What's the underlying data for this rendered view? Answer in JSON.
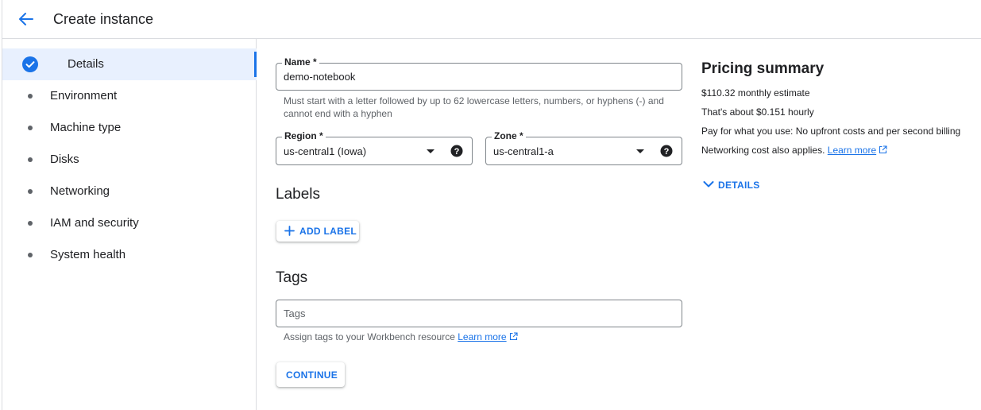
{
  "header": {
    "title": "Create instance"
  },
  "sidebar": {
    "items": [
      {
        "label": "Details"
      },
      {
        "label": "Environment"
      },
      {
        "label": "Machine type"
      },
      {
        "label": "Disks"
      },
      {
        "label": "Networking"
      },
      {
        "label": "IAM and security"
      },
      {
        "label": "System health"
      }
    ]
  },
  "form": {
    "name": {
      "label": "Name *",
      "value": "demo-notebook",
      "hint_line1": "Must start with a letter followed by up to 62 lowercase letters, numbers, or hyphens (-) and",
      "hint_line2": "cannot end with a hyphen"
    },
    "region": {
      "label": "Region *",
      "value": "us-central1 (Iowa)"
    },
    "zone": {
      "label": "Zone *",
      "value": "us-central1-a"
    },
    "labels": {
      "title": "Labels",
      "add_button": "ADD LABEL"
    },
    "tags": {
      "title": "Tags",
      "placeholder": "Tags",
      "hint": "Assign tags to your Workbench resource",
      "learn_more": "Learn more"
    },
    "continue_button": "CONTINUE"
  },
  "pricing": {
    "title": "Pricing summary",
    "monthly": "$110.32 monthly estimate",
    "hourly": "That's about $0.151 hourly",
    "billing": "Pay for what you use: No upfront costs and per second billing",
    "networking": "Networking cost also applies.",
    "learn_more": "Learn more",
    "details_toggle": "DETAILS"
  },
  "colors": {
    "accent": "#1a73e8",
    "text": "#202124",
    "muted": "#5f6368",
    "border": "#dadce0"
  },
  "icons": {
    "back": "arrow-left-icon",
    "check": "check-circle-icon",
    "help": "help-circle-icon",
    "dropdown": "caret-down-icon",
    "add": "plus-icon",
    "external": "external-link-icon",
    "expand": "chevron-down-icon"
  }
}
